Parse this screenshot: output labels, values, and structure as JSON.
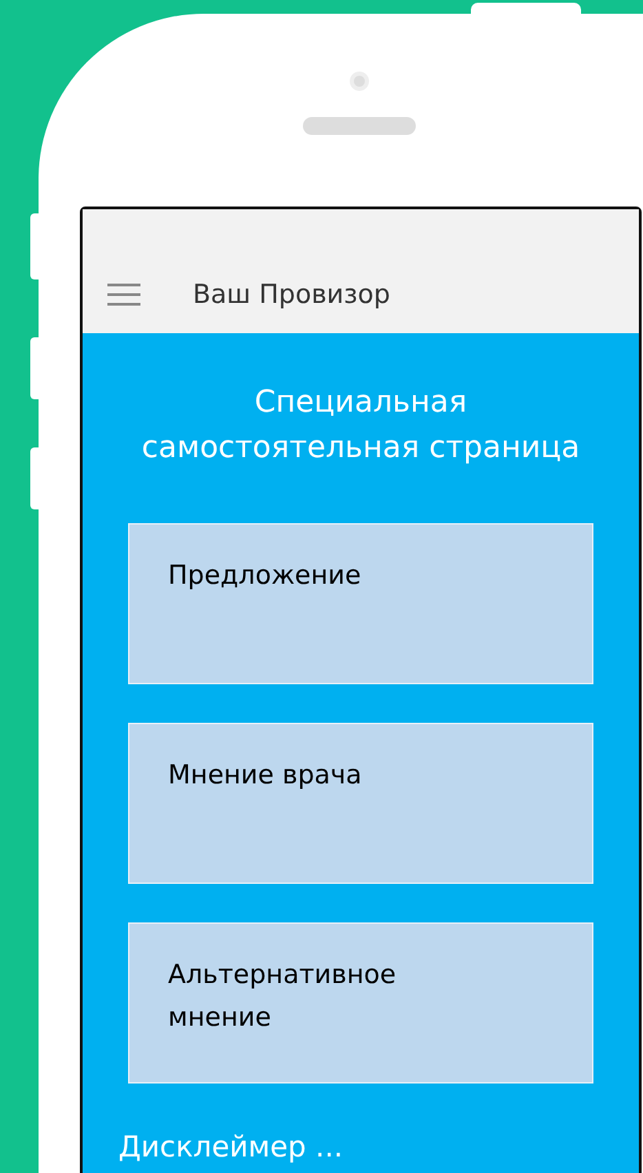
{
  "app_bar": {
    "title": "Ваш Провизор"
  },
  "heading": "Специальная самостоятельная страница",
  "cards": [
    {
      "label": "Предложение"
    },
    {
      "label": "Мнение врача"
    },
    {
      "label": "Альтернативное мнение"
    }
  ],
  "disclaimer": "Дисклеймер ..."
}
